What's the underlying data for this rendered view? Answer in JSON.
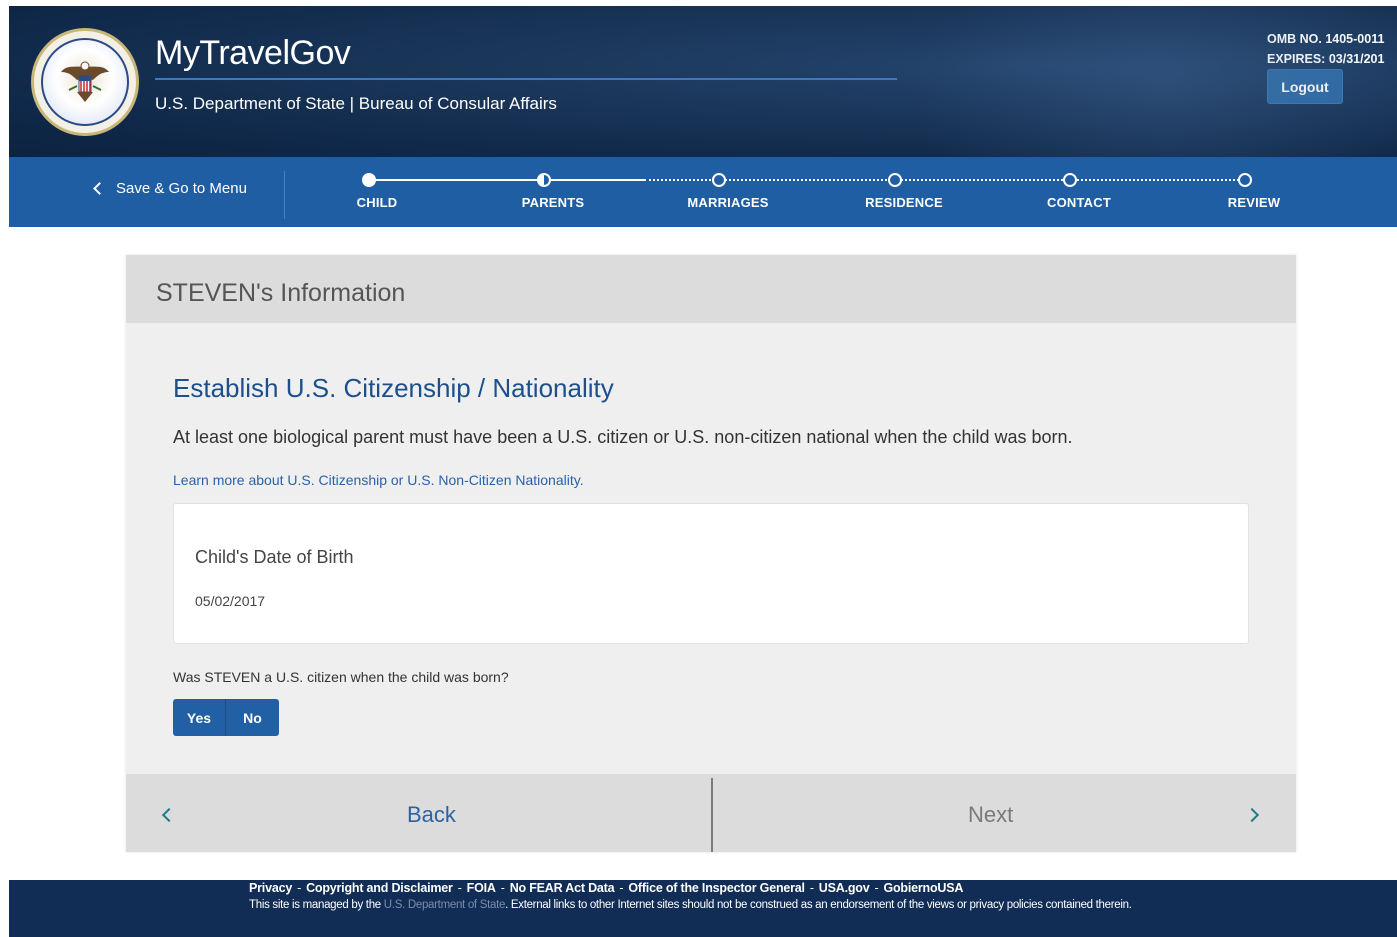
{
  "header": {
    "app_title": "MyTravelGov",
    "department": "U.S. Department of State | Bureau of Consular Affairs",
    "omb_number": "OMB NO. 1405-0011",
    "expires": "EXPIRES: 03/31/201",
    "logout_label": "Logout"
  },
  "progress": {
    "save_menu_label": "Save & Go to Menu",
    "steps": [
      {
        "label": "CHILD",
        "state": "complete"
      },
      {
        "label": "PARENTS",
        "state": "current"
      },
      {
        "label": "MARRIAGES",
        "state": "upcoming"
      },
      {
        "label": "RESIDENCE",
        "state": "upcoming"
      },
      {
        "label": "CONTACT",
        "state": "upcoming"
      },
      {
        "label": "REVIEW",
        "state": "upcoming"
      }
    ]
  },
  "panel": {
    "title": "STEVEN's Information",
    "section_title": "Establish U.S. Citizenship / Nationality",
    "intro": "At least one biological parent must have been a U.S. citizen or U.S. non-citizen national when the child was born.",
    "learn_more_link": "Learn more about U.S. Citizenship or U.S. Non-Citizen Nationality.",
    "dob_label": "Child's Date of Birth",
    "dob_value": "05/02/2017",
    "question": "Was STEVEN a U.S. citizen when the child was born?",
    "yes_label": "Yes",
    "no_label": "No",
    "back_label": "Back",
    "next_label": "Next"
  },
  "footer": {
    "links": [
      "Privacy",
      "Copyright and Disclaimer",
      "FOIA",
      "No FEAR Act Data",
      "Office of the Inspector General",
      "USA.gov",
      "GobiernoUSA"
    ],
    "separator": "-",
    "note_prefix": "This site is managed by the ",
    "note_dept": "U.S. Department of State",
    "note_suffix": ". External links to other Internet sites should not be construed as an endorsement of the views or privacy policies contained therein."
  },
  "colors": {
    "header_bg": "#10294a",
    "nav_blue": "#205ea3",
    "link_blue": "#2a62a8",
    "heading_blue": "#1c4f8c",
    "footer_bg": "#112d55"
  }
}
